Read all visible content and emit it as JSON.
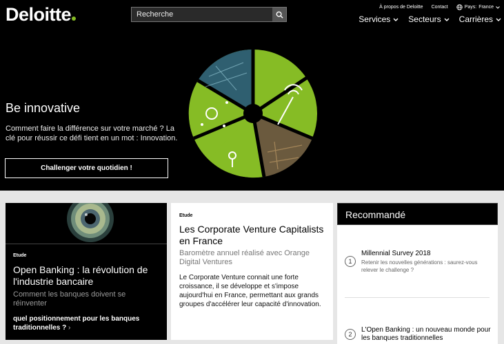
{
  "brand": {
    "name": "Deloitte",
    "accent_color": "#86bc25"
  },
  "search": {
    "placeholder": "Recherche",
    "icon": "search-icon"
  },
  "utility_nav": {
    "about": "À propos de Deloitte",
    "contact": "Contact",
    "country_label": "Pays:",
    "country_value": "France"
  },
  "main_nav": [
    {
      "label": "Services"
    },
    {
      "label": "Secteurs"
    },
    {
      "label": "Carrières"
    }
  ],
  "hero": {
    "title": "Be innovative",
    "text": "Comment faire la différence sur votre marché ? La clé pour réussir ce défi tient en un mot : Innovation.",
    "button": "Challenger votre quotidien !"
  },
  "card1": {
    "tag": "Etude",
    "title": "Open Banking : la révolution de l'industrie bancaire",
    "subtitle": "Comment les banques doivent se réinventer",
    "link": "quel positionnement pour les banques traditionnelles ?"
  },
  "card2": {
    "tag": "Etude",
    "title": "Les Corporate Venture Capitalists en France",
    "subtitle": "Baromètre annuel réalisé avec Orange Digital Ventures",
    "text": "Le Corporate Venture connait une forte croissance, il se développe et s'impose aujourd'hui en France, permettant aux grands groupes d'accélérer leur capacité d'innovation."
  },
  "recommended": {
    "heading": "Recommandé",
    "items": [
      {
        "num": "1",
        "title": "Millennial Survey 2018",
        "subtitle": "Retenir les nouvelles générations : saurez-vous relever le challenge ?"
      },
      {
        "num": "2",
        "title": "L'Open Banking : un nouveau monde pour les banques traditionnelles",
        "subtitle": ""
      }
    ]
  }
}
